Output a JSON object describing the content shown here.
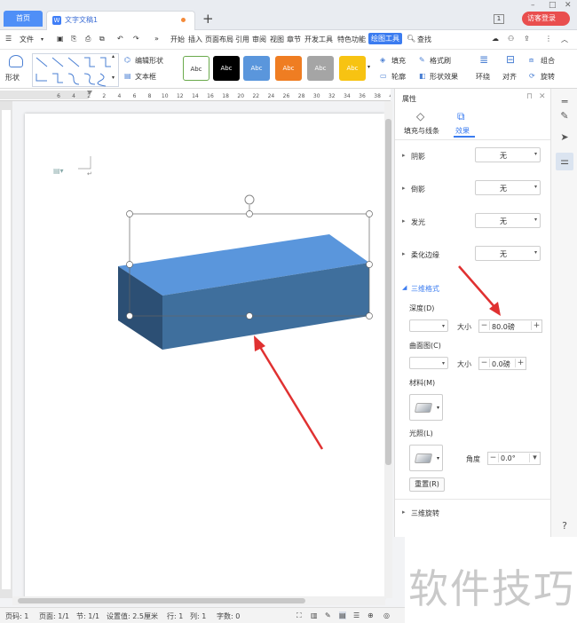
{
  "tabs": {
    "home": "首页",
    "doc": "文字文稿1",
    "badge": "1",
    "login": "访客登录"
  },
  "menu": {
    "file": "文件",
    "items": [
      "开始",
      "插入",
      "页面布局",
      "引用",
      "审阅",
      "视图",
      "章节",
      "开发工具",
      "特色功能"
    ],
    "active": "绘图工具",
    "search": "查找"
  },
  "ribbon": {
    "shape": "形状",
    "edit_shape": "编辑形状",
    "textbox": "文本框",
    "styles": [
      "Abc",
      "Abc",
      "Abc",
      "Abc",
      "Abc",
      "Abc"
    ],
    "fill": "填充",
    "format_brush": "格式刷",
    "outline": "轮廓",
    "shape_effect": "形状效果",
    "wrap": "环绕",
    "align": "对齐",
    "group": "组合",
    "rotate": "旋转"
  },
  "ruler": [
    "6",
    "4",
    "2",
    "2",
    "4",
    "6",
    "8",
    "10",
    "12",
    "14",
    "16",
    "18",
    "20",
    "22",
    "24",
    "26",
    "28",
    "30",
    "32",
    "34",
    "36",
    "38",
    "40"
  ],
  "panel": {
    "title": "属性",
    "tab_fill": "填充与线条",
    "tab_effect": "效果",
    "shadow": "阴影",
    "reflection": "倒影",
    "glow": "发光",
    "soft_edge": "柔化边缘",
    "none": "无",
    "three_d_format": "三维格式",
    "depth": "深度(D)",
    "size": "大小",
    "depth_value": "80.0磅",
    "contour": "曲面图(C)",
    "contour_value": "0.0磅",
    "material": "材料(M)",
    "lighting": "光照(L)",
    "angle": "角度",
    "angle_value": "0.0°",
    "reset": "重置(R)",
    "three_d_rotation": "三维旋转"
  },
  "status": {
    "page_num": "页码: 1",
    "pages": "页面: 1/1",
    "section": "节: 1/1",
    "setting": "设置值: 2.5厘米",
    "row": "行: 1",
    "col": "列: 1",
    "words": "字数: 0"
  },
  "watermark": "软件技巧",
  "colors": {
    "accent": "#3b7cf0",
    "box_top": "#5a96dc",
    "box_front": "#3f6f9d",
    "box_side": "#2c4f74",
    "arrow": "#e03131"
  }
}
